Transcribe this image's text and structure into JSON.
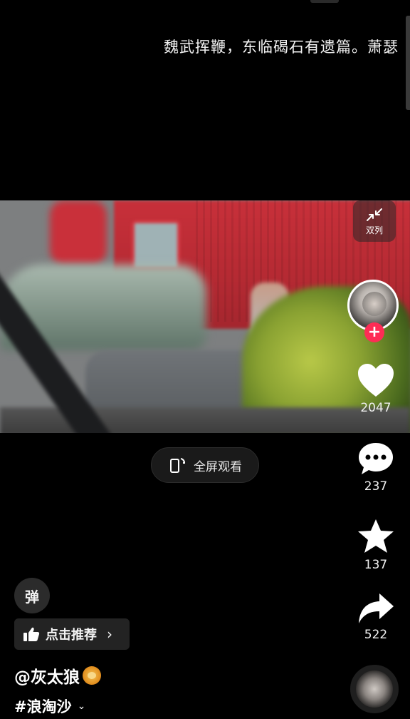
{
  "ticker": {
    "text": "魏武挥鞭，东临碣石有遗篇。萧瑟"
  },
  "video_controls": {
    "collapse_label": "双列",
    "fullscreen_label": "全屏观看"
  },
  "sidebar": {
    "follow_symbol": "+",
    "like_count": "2047",
    "comment_count": "237",
    "favorite_count": "137",
    "share_count": "522"
  },
  "bottom": {
    "danmu_label": "弹",
    "recommend_label": "点击推荐",
    "recommend_chevron": "›",
    "author_name": "@灰太狼",
    "hashtag": "#浪淘沙",
    "hashtag_chevron": "⌄"
  },
  "colors": {
    "accent": "#fe2c55",
    "background": "#000000"
  },
  "icons": {
    "collapse": "collapse-arrows-icon",
    "fullscreen": "rotate-phone-icon",
    "like": "heart-icon",
    "comment": "comment-bubble-icon",
    "favorite": "star-icon",
    "share": "share-arrow-icon",
    "recommend": "thumbs-up-icon",
    "author_badge": "lion-emoji-icon",
    "music": "music-disc-icon"
  }
}
